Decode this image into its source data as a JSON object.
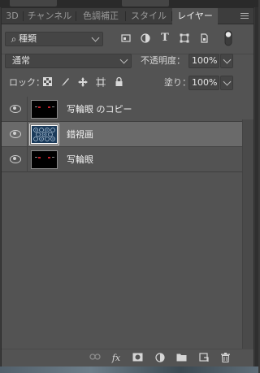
{
  "tabs": [
    {
      "label": "3D",
      "active": false
    },
    {
      "label": "チャンネル",
      "active": false
    },
    {
      "label": "色調補正",
      "active": false
    },
    {
      "label": "スタイル",
      "active": false
    },
    {
      "label": "レイヤー",
      "active": true
    }
  ],
  "filter": {
    "kind_label": "種類"
  },
  "filter_icons": [
    "image-filter-icon",
    "adjustment-filter-icon",
    "type-filter-icon",
    "shape-filter-icon",
    "smart-object-filter-icon",
    "filter-toggle-icon"
  ],
  "blend": {
    "mode": "通常",
    "opacity_label": "不透明度：",
    "opacity": "100%"
  },
  "lock": {
    "label": "ロック：",
    "fill_label": "塗り：",
    "fill": "100%"
  },
  "layers": [
    {
      "name": "写輪眼 のコピー",
      "selected": false,
      "visible": true
    },
    {
      "name": "錯視画",
      "selected": true,
      "visible": true
    },
    {
      "name": "写輪眼",
      "selected": false,
      "visible": true
    }
  ],
  "colors": {
    "panel_bg": "#535353",
    "selected_row": "#6a6a6a",
    "eye_red": "#c8202a"
  }
}
